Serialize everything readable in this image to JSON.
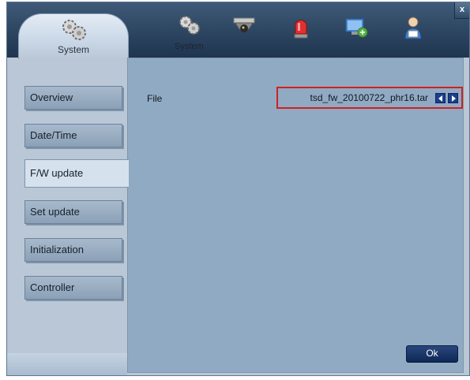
{
  "window": {
    "close_label": "x"
  },
  "header": {
    "active_tab_label": "System",
    "tools": [
      {
        "label": "System",
        "icon": "gears-icon"
      },
      {
        "label": "",
        "icon": "camera-icon"
      },
      {
        "label": "",
        "icon": "alarm-icon"
      },
      {
        "label": "",
        "icon": "network-icon"
      },
      {
        "label": "",
        "icon": "user-icon"
      }
    ]
  },
  "sidebar": {
    "items": [
      {
        "label": "Overview"
      },
      {
        "label": "Date/Time"
      },
      {
        "label": "F/W update",
        "active": true
      },
      {
        "label": "Set update"
      },
      {
        "label": "Initialization"
      },
      {
        "label": "Controller"
      }
    ]
  },
  "main": {
    "file_label": "File",
    "file_value": "tsd_fw_20100722_phr16.tar",
    "ok_label": "Ok"
  },
  "colors": {
    "highlight_border": "#d12020",
    "button_dark": "#0e2856"
  }
}
